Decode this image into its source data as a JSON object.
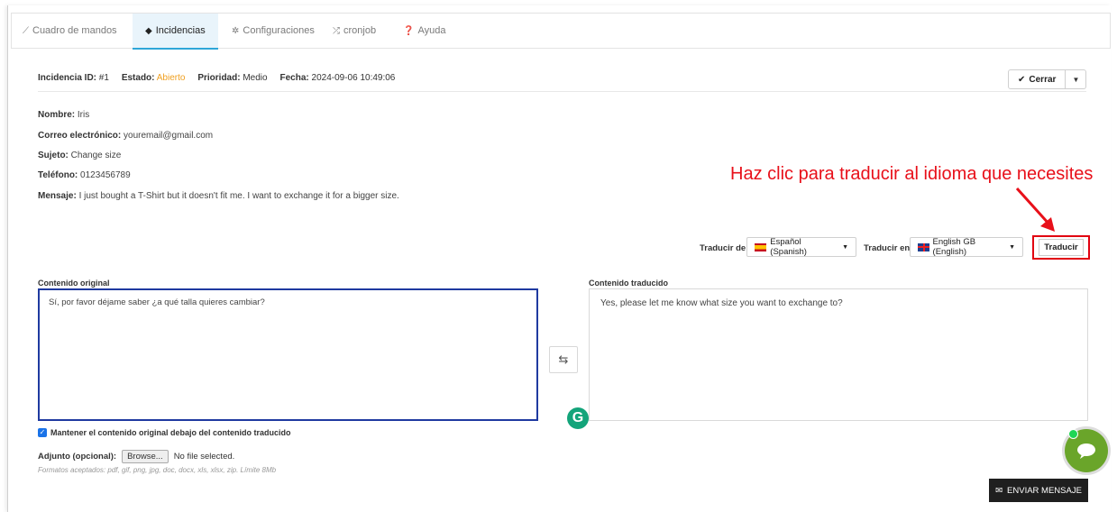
{
  "tabs": [
    {
      "label": "Cuadro de mandos",
      "icon": "chart-line-icon"
    },
    {
      "label": "Incidencias",
      "icon": "tag-icon"
    },
    {
      "label": "Configuraciones",
      "icon": "gear-icon"
    },
    {
      "label": "cronjob",
      "icon": "shuffle-icon"
    },
    {
      "label": "Ayuda",
      "icon": "question-circle-icon"
    }
  ],
  "ticket": {
    "id_label": "Incidencia ID:",
    "id_value": "#1",
    "estado_label": "Estado:",
    "estado_value": "Abierto",
    "prioridad_label": "Prioridad:",
    "prioridad_value": "Medio",
    "fecha_label": "Fecha:",
    "fecha_value": "2024-09-06 10:49:06",
    "close_label": "Cerrar"
  },
  "details": {
    "nombre_label": "Nombre:",
    "nombre_value": "Iris",
    "correo_label": "Correo electrónico:",
    "correo_value": "youremail@gmail.com",
    "sujeto_label": "Sujeto:",
    "sujeto_value": "Change size",
    "telefono_label": "Teléfono:",
    "telefono_value": "0123456789",
    "mensaje_label": "Mensaje:",
    "mensaje_value": "I just bought a T-Shirt but it doesn't fit me. I want to exchange it for a bigger size."
  },
  "annotation": "Haz clic para traducir al idioma que necesites",
  "translate": {
    "from_label": "Traducir de",
    "from_value": "Español (Spanish)",
    "to_label": "Traducir en",
    "to_value": "English GB (English)",
    "button": "Traducir"
  },
  "original": {
    "label": "Contenido original",
    "text": "Sí, por favor déjame saber ¿a qué talla quieres cambiar?"
  },
  "translated": {
    "label": "Contenido traducido",
    "text": "Yes, please let me know what size you want to exchange to?"
  },
  "keep_original": "Mantener el contenido original debajo del contenido traducido",
  "attachment": {
    "label": "Adjunto (opcional):",
    "browse": "Browse...",
    "status": "No file selected.",
    "formats": "Formatos aceptados: pdf, gif, png, jpg, doc, docx, xls, xlsx, zip. Límite 8Mb"
  },
  "send_label": "ENVIAR MENSAJE",
  "colors": {
    "accent": "#2ea6d8",
    "status_open": "#f0a020",
    "annotation": "#e8101a",
    "chat": "#6aa52a"
  }
}
